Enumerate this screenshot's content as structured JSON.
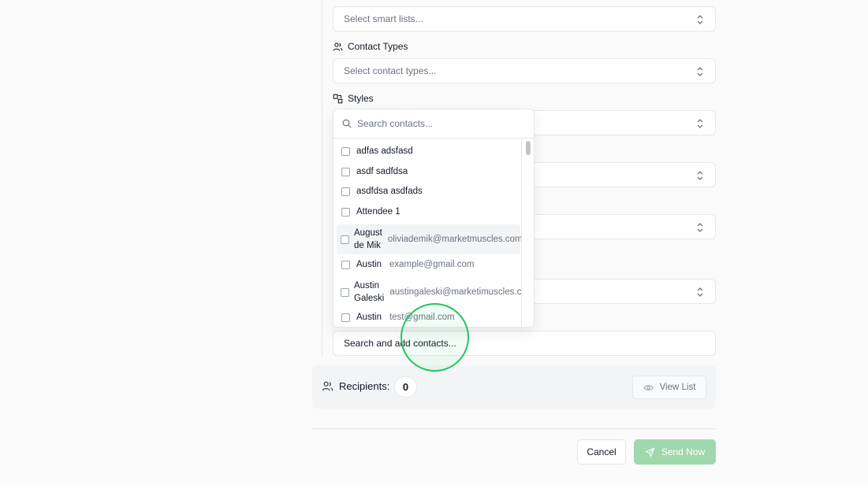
{
  "smart_lists": {
    "placeholder": "Select smart lists..."
  },
  "contact_types": {
    "label": "Contact Types",
    "placeholder": "Select contact types..."
  },
  "styles": {
    "label": "Styles"
  },
  "contact_search": {
    "placeholder": "Search contacts...",
    "items": [
      {
        "name": "adfas adsfasd",
        "email": ""
      },
      {
        "name": "asdf sadfdsa",
        "email": ""
      },
      {
        "name": "asdfdsa asdfads",
        "email": ""
      },
      {
        "name": "Attendee 1",
        "email": ""
      },
      {
        "name": "August de Mik",
        "email": "oliviademik@marketmuscles.com"
      },
      {
        "name": "Austin",
        "email": "example@gmail.com"
      },
      {
        "name": "Austin Galeski",
        "email": "austingaleski@marketimuscles.com"
      },
      {
        "name": "Austin",
        "email": "test@gmail.com"
      }
    ]
  },
  "add_contacts": {
    "text": "Search and add contacts..."
  },
  "recipients": {
    "label": "Recipients:",
    "count": "0",
    "view_list": "View List"
  },
  "footer": {
    "cancel": "Cancel",
    "send": "Send Now"
  },
  "colors": {
    "accent": "#22c55e",
    "send_disabled": "#9fd8ad"
  }
}
